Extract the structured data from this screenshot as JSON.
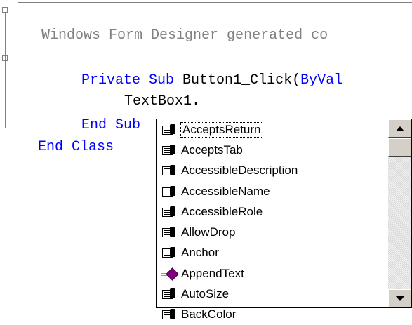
{
  "editor": {
    "region_label": "Windows Form Designer generated co",
    "line_sub_kw1": "Private Sub",
    "line_sub_id": " Button1_Click(",
    "line_sub_kw2": "ByVal",
    "line_textbox": "TextBox1.",
    "line_end_sub": "End Sub",
    "line_end_class": "End Class"
  },
  "intellisense": {
    "items": [
      {
        "label": "AcceptsReturn",
        "icon": "property-icon"
      },
      {
        "label": "AcceptsTab",
        "icon": "property-icon"
      },
      {
        "label": "AccessibleDescription",
        "icon": "property-icon"
      },
      {
        "label": "AccessibleName",
        "icon": "property-icon"
      },
      {
        "label": "AccessibleRole",
        "icon": "property-icon"
      },
      {
        "label": "AllowDrop",
        "icon": "property-icon"
      },
      {
        "label": "Anchor",
        "icon": "property-icon"
      },
      {
        "label": "AppendText",
        "icon": "method-icon"
      },
      {
        "label": "AutoSize",
        "icon": "property-icon"
      },
      {
        "label": "BackColor",
        "icon": "property-icon"
      }
    ],
    "selected": "AcceptsReturn"
  },
  "colors": {
    "keyword": "#0000ff",
    "identifier": "#000000",
    "collapsed_region": "#808080",
    "method_icon": "#800080"
  }
}
